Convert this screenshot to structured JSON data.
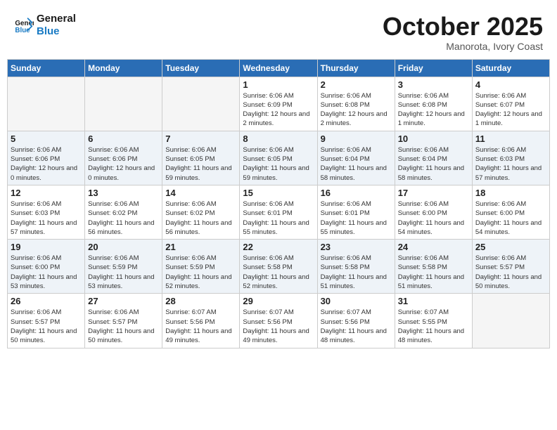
{
  "header": {
    "logo_line1": "General",
    "logo_line2": "Blue",
    "month": "October 2025",
    "location": "Manorota, Ivory Coast"
  },
  "weekdays": [
    "Sunday",
    "Monday",
    "Tuesday",
    "Wednesday",
    "Thursday",
    "Friday",
    "Saturday"
  ],
  "weeks": [
    [
      {
        "day": "",
        "info": ""
      },
      {
        "day": "",
        "info": ""
      },
      {
        "day": "",
        "info": ""
      },
      {
        "day": "1",
        "info": "Sunrise: 6:06 AM\nSunset: 6:09 PM\nDaylight: 12 hours and 2 minutes."
      },
      {
        "day": "2",
        "info": "Sunrise: 6:06 AM\nSunset: 6:08 PM\nDaylight: 12 hours and 2 minutes."
      },
      {
        "day": "3",
        "info": "Sunrise: 6:06 AM\nSunset: 6:08 PM\nDaylight: 12 hours and 1 minute."
      },
      {
        "day": "4",
        "info": "Sunrise: 6:06 AM\nSunset: 6:07 PM\nDaylight: 12 hours and 1 minute."
      }
    ],
    [
      {
        "day": "5",
        "info": "Sunrise: 6:06 AM\nSunset: 6:06 PM\nDaylight: 12 hours and 0 minutes."
      },
      {
        "day": "6",
        "info": "Sunrise: 6:06 AM\nSunset: 6:06 PM\nDaylight: 12 hours and 0 minutes."
      },
      {
        "day": "7",
        "info": "Sunrise: 6:06 AM\nSunset: 6:05 PM\nDaylight: 11 hours and 59 minutes."
      },
      {
        "day": "8",
        "info": "Sunrise: 6:06 AM\nSunset: 6:05 PM\nDaylight: 11 hours and 59 minutes."
      },
      {
        "day": "9",
        "info": "Sunrise: 6:06 AM\nSunset: 6:04 PM\nDaylight: 11 hours and 58 minutes."
      },
      {
        "day": "10",
        "info": "Sunrise: 6:06 AM\nSunset: 6:04 PM\nDaylight: 11 hours and 58 minutes."
      },
      {
        "day": "11",
        "info": "Sunrise: 6:06 AM\nSunset: 6:03 PM\nDaylight: 11 hours and 57 minutes."
      }
    ],
    [
      {
        "day": "12",
        "info": "Sunrise: 6:06 AM\nSunset: 6:03 PM\nDaylight: 11 hours and 57 minutes."
      },
      {
        "day": "13",
        "info": "Sunrise: 6:06 AM\nSunset: 6:02 PM\nDaylight: 11 hours and 56 minutes."
      },
      {
        "day": "14",
        "info": "Sunrise: 6:06 AM\nSunset: 6:02 PM\nDaylight: 11 hours and 56 minutes."
      },
      {
        "day": "15",
        "info": "Sunrise: 6:06 AM\nSunset: 6:01 PM\nDaylight: 11 hours and 55 minutes."
      },
      {
        "day": "16",
        "info": "Sunrise: 6:06 AM\nSunset: 6:01 PM\nDaylight: 11 hours and 55 minutes."
      },
      {
        "day": "17",
        "info": "Sunrise: 6:06 AM\nSunset: 6:00 PM\nDaylight: 11 hours and 54 minutes."
      },
      {
        "day": "18",
        "info": "Sunrise: 6:06 AM\nSunset: 6:00 PM\nDaylight: 11 hours and 54 minutes."
      }
    ],
    [
      {
        "day": "19",
        "info": "Sunrise: 6:06 AM\nSunset: 6:00 PM\nDaylight: 11 hours and 53 minutes."
      },
      {
        "day": "20",
        "info": "Sunrise: 6:06 AM\nSunset: 5:59 PM\nDaylight: 11 hours and 53 minutes."
      },
      {
        "day": "21",
        "info": "Sunrise: 6:06 AM\nSunset: 5:59 PM\nDaylight: 11 hours and 52 minutes."
      },
      {
        "day": "22",
        "info": "Sunrise: 6:06 AM\nSunset: 5:58 PM\nDaylight: 11 hours and 52 minutes."
      },
      {
        "day": "23",
        "info": "Sunrise: 6:06 AM\nSunset: 5:58 PM\nDaylight: 11 hours and 51 minutes."
      },
      {
        "day": "24",
        "info": "Sunrise: 6:06 AM\nSunset: 5:58 PM\nDaylight: 11 hours and 51 minutes."
      },
      {
        "day": "25",
        "info": "Sunrise: 6:06 AM\nSunset: 5:57 PM\nDaylight: 11 hours and 50 minutes."
      }
    ],
    [
      {
        "day": "26",
        "info": "Sunrise: 6:06 AM\nSunset: 5:57 PM\nDaylight: 11 hours and 50 minutes."
      },
      {
        "day": "27",
        "info": "Sunrise: 6:06 AM\nSunset: 5:57 PM\nDaylight: 11 hours and 50 minutes."
      },
      {
        "day": "28",
        "info": "Sunrise: 6:07 AM\nSunset: 5:56 PM\nDaylight: 11 hours and 49 minutes."
      },
      {
        "day": "29",
        "info": "Sunrise: 6:07 AM\nSunset: 5:56 PM\nDaylight: 11 hours and 49 minutes."
      },
      {
        "day": "30",
        "info": "Sunrise: 6:07 AM\nSunset: 5:56 PM\nDaylight: 11 hours and 48 minutes."
      },
      {
        "day": "31",
        "info": "Sunrise: 6:07 AM\nSunset: 5:55 PM\nDaylight: 11 hours and 48 minutes."
      },
      {
        "day": "",
        "info": ""
      }
    ]
  ]
}
